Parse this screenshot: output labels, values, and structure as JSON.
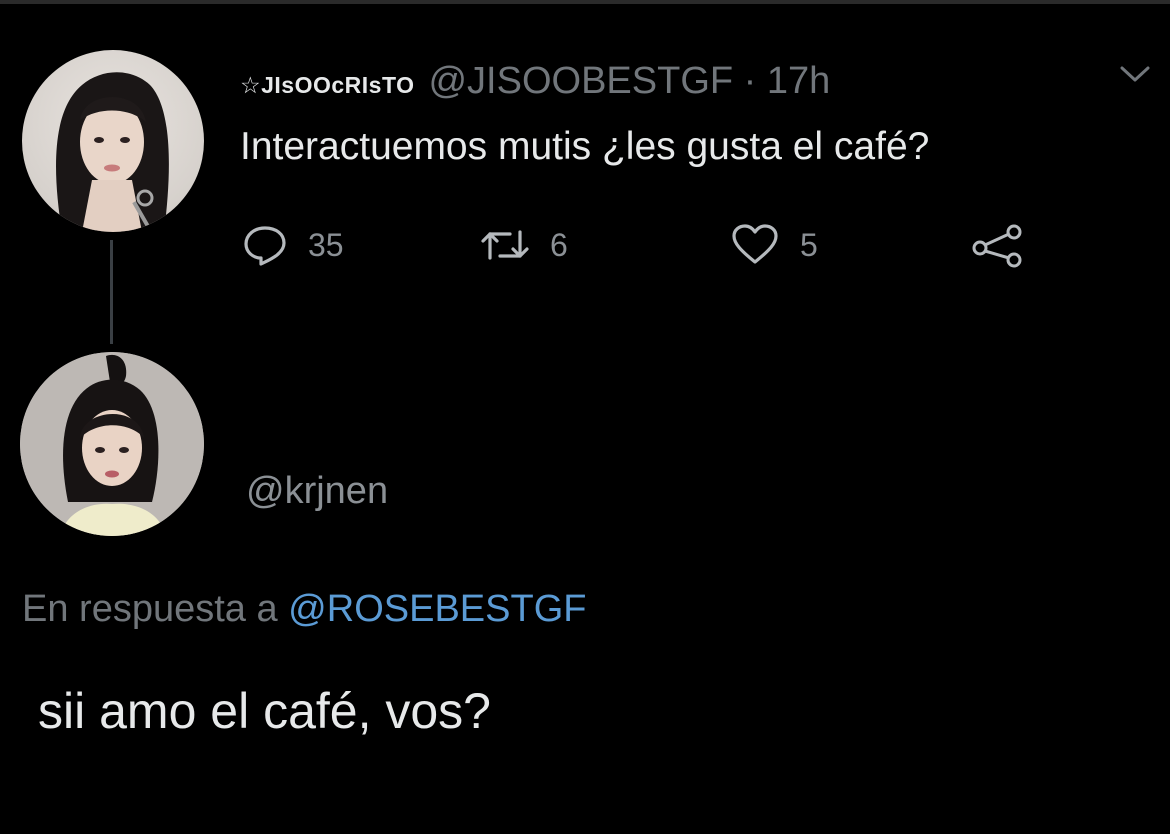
{
  "tweet": {
    "display_name": "☆JIsOOcRIsTO",
    "handle": "@JISOOBESTGF",
    "separator": " · ",
    "time": "17h",
    "text": "Interactuemos mutis ¿les gusta el café?",
    "actions": {
      "replies": "35",
      "retweets": "6",
      "likes": "5"
    }
  },
  "reply": {
    "handle": "@krjnen",
    "context_prefix": "En respuesta a ",
    "context_mention": "@ROSEBESTGF",
    "text": "sii amo el café, vos?"
  },
  "icons": {
    "more": "chevron-down-icon",
    "reply": "speech-bubble-icon",
    "retweet": "retweet-icon",
    "like": "heart-icon",
    "share": "share-nodes-icon"
  },
  "colors": {
    "background": "#000000",
    "text": "#e7e9ea",
    "secondary": "#71767b",
    "mention": "#5b9bd5",
    "thread_line": "#3a3f44"
  }
}
